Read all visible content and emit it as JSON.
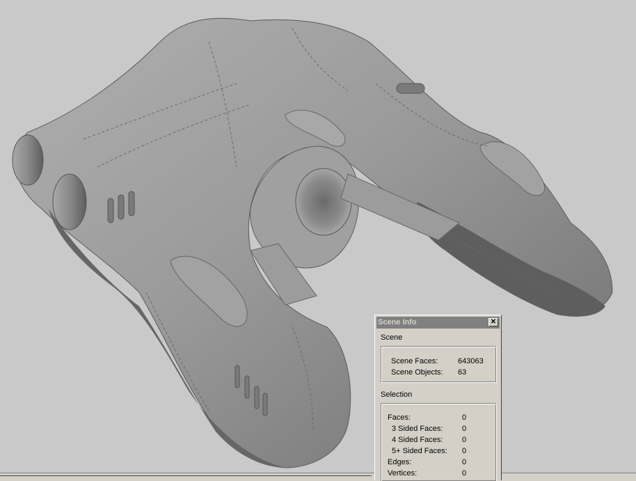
{
  "viewport": {
    "background": "#c9c9c9",
    "model_color": "#8e8e8e"
  },
  "dialog": {
    "title": "Scene Info",
    "close_label": "✕",
    "scene": {
      "label": "Scene",
      "faces_label": "Scene Faces:",
      "faces_value": "643063",
      "objects_label": "Scene Objects:",
      "objects_value": "63"
    },
    "selection": {
      "label": "Selection",
      "faces_label": "Faces:",
      "faces_value": "0",
      "three_sided_label": "3 Sided Faces:",
      "three_sided_value": "0",
      "four_sided_label": "4 Sided Faces:",
      "four_sided_value": "0",
      "five_plus_label": "5+ Sided Faces:",
      "five_plus_value": "0",
      "edges_label": "Edges:",
      "edges_value": "0",
      "vertices_label": "Vertices:",
      "vertices_value": "0"
    }
  }
}
